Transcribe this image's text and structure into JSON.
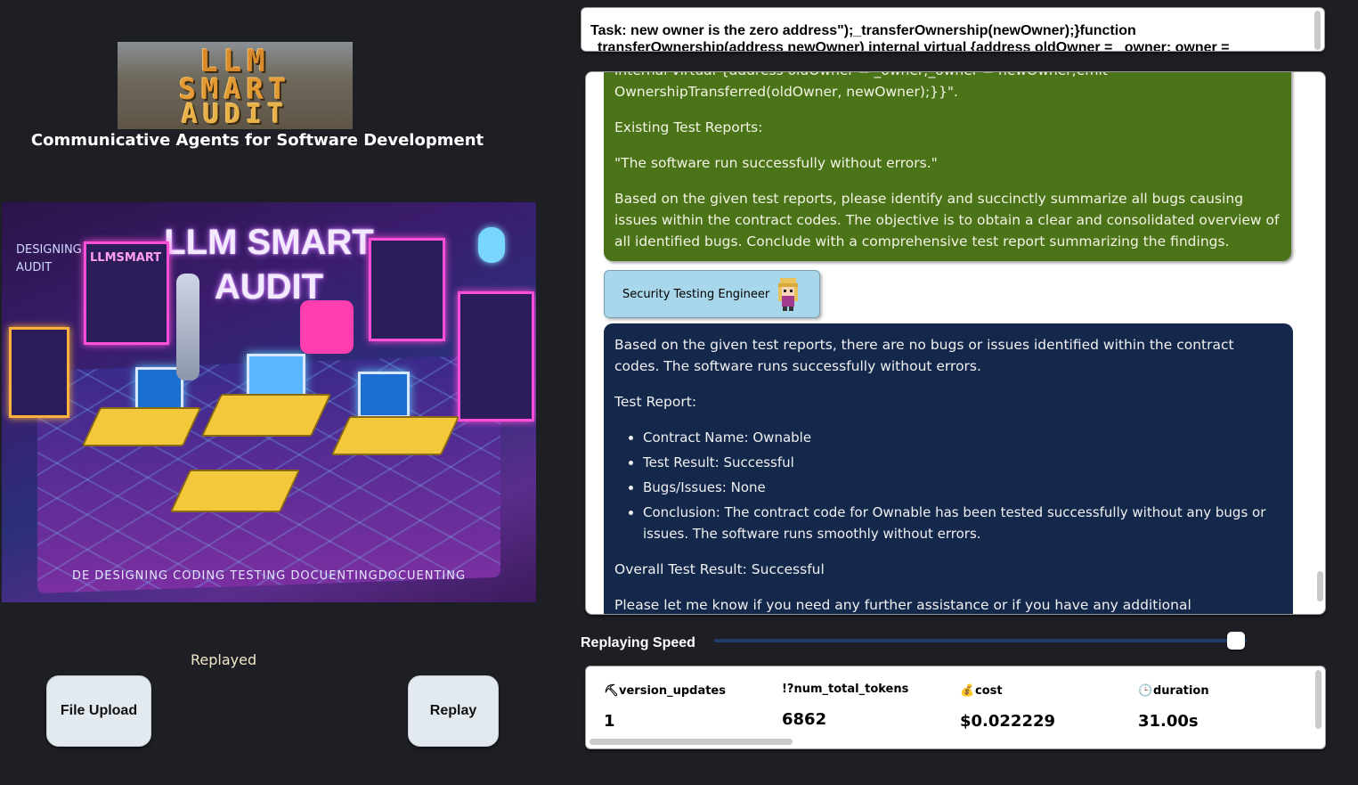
{
  "left": {
    "logo_text": [
      "LLM",
      "SMART",
      "AUDIT"
    ],
    "subtitle": "Communicative Agents for Software Development",
    "hero": {
      "title_line1": "LLM SMART",
      "title_line2": "AUDIT",
      "corner_line1": "DESIGNING",
      "corner_line2": "AUDIT",
      "panel_text": "LLMSMART",
      "caption": "DE  DESIGNING     CODING  TESTING  DOCUENTINGDOCUENTING"
    },
    "status_label": "Replayed",
    "file_upload_label": "File Upload",
    "replay_label": "Replay"
  },
  "task": {
    "line1": "Task: new owner is the zero address\");_transferOwnership(newOwner);}function",
    "line2": "transferOwnership(address newOwner) internal virtual {address oldOwner = _owner; owner ="
  },
  "chat": {
    "green_message": {
      "p0": "internal virtual {address oldOwner = _owner;_owner = newOwner;emit OwnershipTransferred(oldOwner, newOwner);}}\".",
      "p1": "Existing Test Reports:",
      "p2": "\"The software run successfully without errors.\"",
      "p3": "Based on the given test reports, please identify and succinctly summarize all bugs causing issues within the contract codes. The objective is to obtain a clear and consolidated overview of all identified bugs. Conclude with a comprehensive test report summarizing the findings."
    },
    "role_tag": "Security Testing Engineer",
    "blue_message": {
      "p0": "Based on the given test reports, there are no bugs or issues identified within the contract codes. The software runs successfully without errors.",
      "p1": "Test Report:",
      "items": [
        "Contract Name: Ownable",
        "Test Result: Successful",
        "Bugs/Issues: None",
        "Conclusion: The contract code for Ownable has been tested successfully without any bugs or issues. The software runs smoothly without errors."
      ],
      "p2": "Overall Test Result: Successful",
      "p3": "Please let me know if you need any further assistance or if you have any additional"
    }
  },
  "speed": {
    "label": "Replaying Speed",
    "value": 0.98
  },
  "stats": [
    {
      "icon": "hammer-icon",
      "glyph": "⛏",
      "key": "version_updates",
      "value": "1"
    },
    {
      "icon": "exclaim-question-icon",
      "glyph": "",
      "key": "!?num_total_tokens",
      "value": "6862"
    },
    {
      "icon": "money-bag-icon",
      "glyph": "💰",
      "key": "cost",
      "value": "$0.022229"
    },
    {
      "icon": "clock-icon",
      "glyph": "🕒",
      "key": "duration",
      "value": "31.00s"
    }
  ]
}
